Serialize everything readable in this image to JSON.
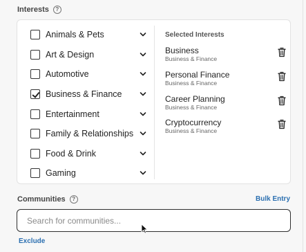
{
  "interests": {
    "label": "Interests",
    "help_icon": "question-circle-icon",
    "categories": [
      {
        "label": "Animals & Pets",
        "checked": false
      },
      {
        "label": "Art & Design",
        "checked": false
      },
      {
        "label": "Automotive",
        "checked": false
      },
      {
        "label": "Business & Finance",
        "checked": true
      },
      {
        "label": "Entertainment",
        "checked": false
      },
      {
        "label": "Family & Relationships",
        "checked": false
      },
      {
        "label": "Food & Drink",
        "checked": false
      },
      {
        "label": "Gaming",
        "checked": false
      }
    ],
    "selected_title": "Selected Interests",
    "selected": [
      {
        "name": "Business",
        "category": "Business & Finance"
      },
      {
        "name": "Personal Finance",
        "category": "Business & Finance"
      },
      {
        "name": "Career Planning",
        "category": "Business & Finance"
      },
      {
        "name": "Cryptocurrency",
        "category": "Business & Finance"
      }
    ]
  },
  "communities": {
    "label": "Communities",
    "help_icon": "question-circle-icon",
    "bulk_entry": "Bulk Entry",
    "search_placeholder": "Search for communities...",
    "search_value": "",
    "exclude": "Exclude"
  },
  "colors": {
    "link": "#2b6fb0",
    "border": "#e2e2e2",
    "background": "#f7f7f7"
  }
}
